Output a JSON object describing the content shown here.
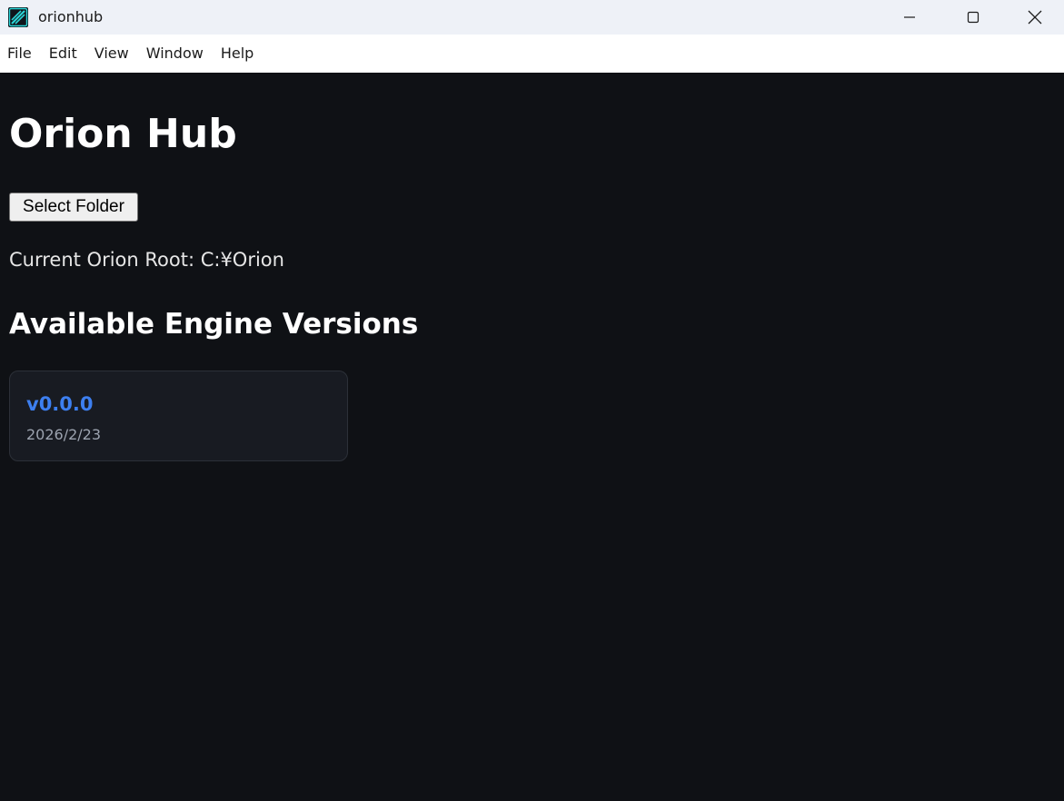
{
  "window": {
    "title": "orionhub",
    "icon": "orion-app-icon",
    "accent_color": "#2ad4d6"
  },
  "menu": {
    "items": [
      "File",
      "Edit",
      "View",
      "Window",
      "Help"
    ]
  },
  "main": {
    "title": "Orion Hub",
    "select_folder_label": "Select Folder",
    "current_root": "Current Orion Root: C:¥Orion",
    "section_title": "Available Engine Versions",
    "versions": [
      {
        "name": "v0.0.0",
        "date": "2026/2/23"
      }
    ]
  },
  "colors": {
    "background": "#0f1115",
    "card_background": "#181b22",
    "version_link": "#3d7ff0"
  }
}
